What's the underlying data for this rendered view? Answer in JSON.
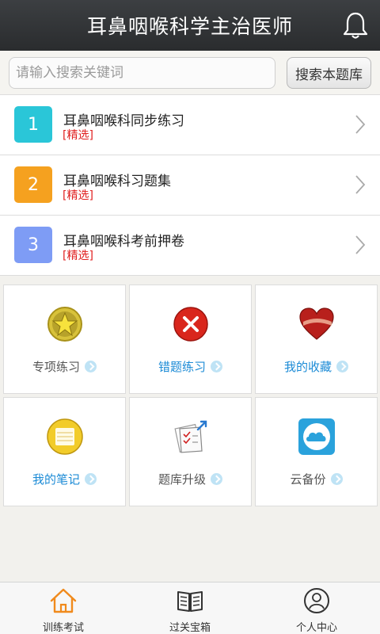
{
  "header": {
    "title": "耳鼻咽喉科学主治医师"
  },
  "search": {
    "placeholder": "请输入搜索关键词",
    "button_label": "搜索本题库"
  },
  "list": {
    "items": [
      {
        "number": "1",
        "title": "耳鼻咽喉科同步练习",
        "tag": "[精选]",
        "color": "#2ac6d8"
      },
      {
        "number": "2",
        "title": "耳鼻咽喉科习题集",
        "tag": "[精选]",
        "color": "#f5a11f"
      },
      {
        "number": "3",
        "title": "耳鼻咽喉科考前押卷",
        "tag": "[精选]",
        "color": "#7e9cf5"
      }
    ]
  },
  "grid": {
    "cells": [
      {
        "label": "专项练习",
        "icon": "star-badge-icon",
        "label_color": "gray"
      },
      {
        "label": "错题练习",
        "icon": "red-x-icon",
        "label_color": "blue"
      },
      {
        "label": "我的收藏",
        "icon": "heart-icon",
        "label_color": "blue"
      },
      {
        "label": "我的笔记",
        "icon": "notepad-icon",
        "label_color": "blue"
      },
      {
        "label": "题库升级",
        "icon": "upgrade-checklist-icon",
        "label_color": "gray"
      },
      {
        "label": "云备份",
        "icon": "cloud-icon",
        "label_color": "gray"
      }
    ]
  },
  "bottom_nav": {
    "items": [
      {
        "label": "训练考试",
        "icon": "home-icon",
        "active": true
      },
      {
        "label": "过关宝箱",
        "icon": "book-icon",
        "active": false
      },
      {
        "label": "个人中心",
        "icon": "user-icon",
        "active": false
      }
    ]
  },
  "colors": {
    "accent_orange": "#f08a1c",
    "tag_red": "#e02020",
    "label_blue": "#1c8bd6"
  }
}
